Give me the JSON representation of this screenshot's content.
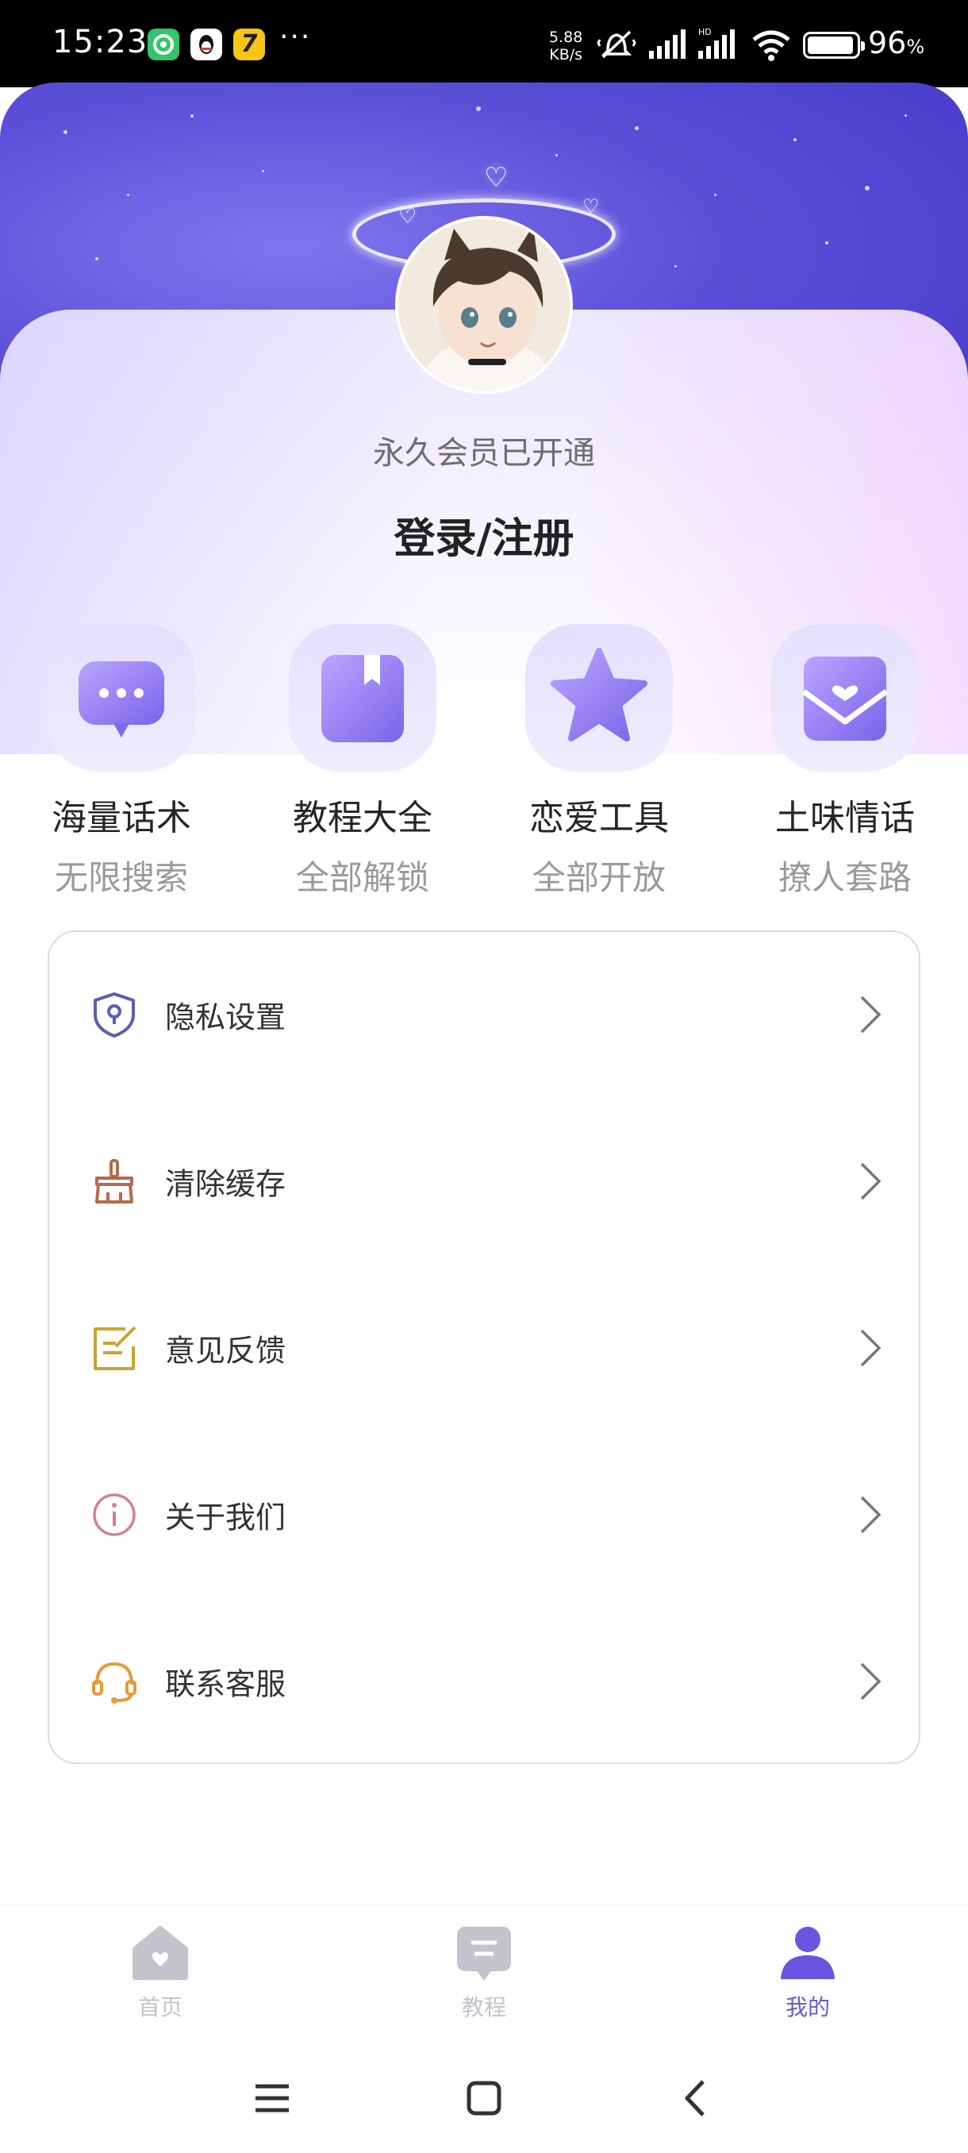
{
  "status_bar": {
    "time": "15:23",
    "notification_icons": [
      "wechat-icon",
      "qq-icon",
      "seven-cat-icon"
    ],
    "more": "···",
    "net_speed_value": "5.88",
    "net_speed_unit": "KB/s",
    "battery_percent": "96",
    "battery_unit": "%"
  },
  "profile": {
    "member_status": "永久会员已开通",
    "login_label": "登录/注册"
  },
  "features": [
    {
      "title": "海量话术",
      "subtitle": "无限搜索",
      "icon": "chat-bubble-icon"
    },
    {
      "title": "教程大全",
      "subtitle": "全部解锁",
      "icon": "bookmark-book-icon"
    },
    {
      "title": "恋爱工具",
      "subtitle": "全部开放",
      "icon": "star-icon"
    },
    {
      "title": "土味情话",
      "subtitle": "撩人套路",
      "icon": "love-letter-icon"
    }
  ],
  "menu": [
    {
      "label": "隐私设置",
      "icon": "privacy-shield-icon",
      "color": "#5b5fb0"
    },
    {
      "label": "清除缓存",
      "icon": "broom-icon",
      "color": "#b46a4a"
    },
    {
      "label": "意见反馈",
      "icon": "feedback-edit-icon",
      "color": "#c9a52c"
    },
    {
      "label": "关于我们",
      "icon": "info-icon",
      "color": "#d77ba0"
    },
    {
      "label": "联系客服",
      "icon": "headset-icon",
      "color": "#e59b3a"
    }
  ],
  "bottom_nav": [
    {
      "label": "首页",
      "icon": "home-heart-icon",
      "active": false
    },
    {
      "label": "教程",
      "icon": "tutorial-message-icon",
      "active": false
    },
    {
      "label": "我的",
      "icon": "user-icon",
      "active": true
    }
  ],
  "colors": {
    "accent": "#6a55e0",
    "header": "#5b4fd8",
    "feature_icon": "#8a76f0",
    "inactive_nav": "#c4c4cc"
  }
}
